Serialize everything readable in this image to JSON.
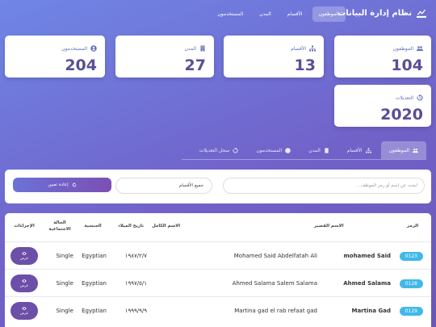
{
  "header": {
    "title": "نظام إدارة البيانات",
    "nav": [
      "الموظفون",
      "الأقسام",
      "المدن",
      "المستخدمون"
    ]
  },
  "stats": [
    {
      "label": "الموظفون",
      "value": "104",
      "icon": "users-icon"
    },
    {
      "label": "الأقسام",
      "value": "13",
      "icon": "sitemap-icon"
    },
    {
      "label": "المدن",
      "value": "27",
      "icon": "building-icon"
    },
    {
      "label": "المستخدمون",
      "value": "204",
      "icon": "user-circle-icon"
    },
    {
      "label": "التعديلات",
      "value": "2020",
      "icon": "history-icon"
    }
  ],
  "tabs": [
    "الموظفون",
    "الأقسام",
    "المدن",
    "المستخدمون",
    "سجل التعديلات"
  ],
  "filter": {
    "search_placeholder": "ابحث عن اسم أو رمز الموظف...",
    "dept_selected": "جميع الأقسام",
    "reset_label": "إعادة تعيين"
  },
  "table": {
    "headers": {
      "code": "الرمز",
      "short": "الاسم القصير",
      "full": "الاسم الكامل",
      "dob": "تاريخ الميلاد",
      "nationality": "الجنسية",
      "marital": "الحالة الاجتماعية",
      "actions": "الإجراءات"
    },
    "view_label": "عرض",
    "rows": [
      {
        "code": "0123",
        "short": "mohamed Said",
        "full": "Mohamed Said Abdelfatah Ali",
        "dob": "١٩٨٧/٢/٧",
        "nationality": "Egyptian",
        "marital": "Single"
      },
      {
        "code": "0128",
        "short": "Ahmed Salama",
        "full": "Ahmed Salama Salem Salama",
        "dob": "١٩٩٧/٥/١",
        "nationality": "Egyptian",
        "marital": "Single"
      },
      {
        "code": "0129",
        "short": "Martina Gad",
        "full": "Martina gad el rab refaat gad",
        "dob": "١٩٩٩/٩/٩",
        "nationality": "Egyptian",
        "marital": "Single"
      }
    ]
  }
}
